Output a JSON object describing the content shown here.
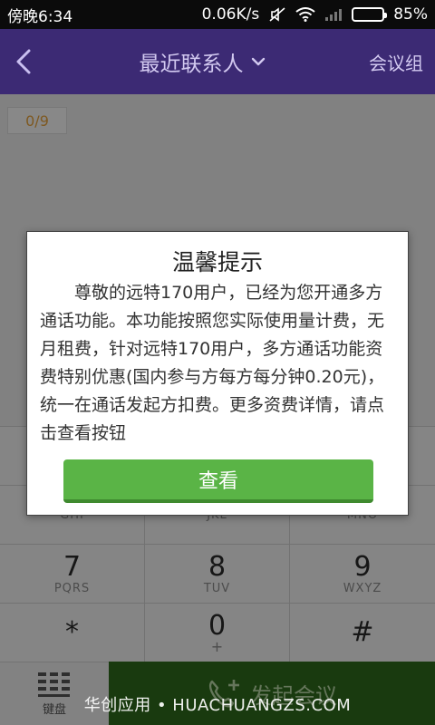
{
  "status_bar": {
    "time": "傍晚6:34",
    "network_speed": "0.06K/s",
    "battery": "85%",
    "battery_level": 0.85,
    "battery_color": "#4cd16b"
  },
  "app_bar": {
    "back_icon": "chevron-left-icon",
    "title": "最近联系人",
    "title_dropdown_icon": "chevron-down-icon",
    "right_action": "会议组",
    "background": "#3c2a74"
  },
  "selection": {
    "counter": "0/9"
  },
  "keypad": {
    "keys": [
      {
        "digit": "",
        "letters": "",
        "plus": ""
      },
      {
        "digit": "",
        "letters": "",
        "plus": ""
      },
      {
        "digit": "",
        "letters": "",
        "plus": ""
      },
      {
        "digit": "",
        "letters": "GHI",
        "plus": ""
      },
      {
        "digit": "",
        "letters": "JKL",
        "plus": ""
      },
      {
        "digit": "",
        "letters": "MNO",
        "plus": ""
      },
      {
        "digit": "7",
        "letters": "PQRS",
        "plus": ""
      },
      {
        "digit": "8",
        "letters": "TUV",
        "plus": ""
      },
      {
        "digit": "9",
        "letters": "WXYZ",
        "plus": ""
      },
      {
        "digit": "*",
        "letters": "",
        "plus": ""
      },
      {
        "digit": "0",
        "letters": "",
        "plus": "+"
      },
      {
        "digit": "#",
        "letters": "",
        "plus": ""
      }
    ]
  },
  "bottom_bar": {
    "keyboard_label": "键盘",
    "keyboard_icon": "keypad-icon",
    "start_meeting_label": "发起会议",
    "start_meeting_icon": "add-call-icon",
    "start_meeting_color": "#2f6b1c"
  },
  "dialog": {
    "title": "温馨提示",
    "body": "尊敬的远特170用户，已经为您开通多方通话功能。本功能按照您实际使用量计费，无月租费，针对远特170用户，多方通话功能资费特别优惠(国内参与方每方每分钟0.20元)，统一在通话发起方扣费。更多资费详情，请点击查看按钮",
    "button_label": "查看",
    "button_color": "#5ab446"
  },
  "watermark": "华创应用 • HUACHUANGZS.COM"
}
